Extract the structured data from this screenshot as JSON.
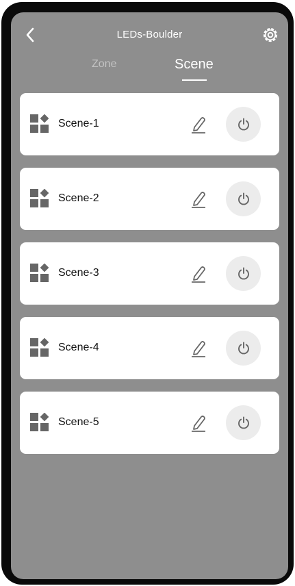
{
  "header": {
    "title": "LEDs-Boulder",
    "back_icon": "chevron-left-icon",
    "settings_icon": "gear-icon"
  },
  "tabs": [
    {
      "label": "Zone",
      "active": false
    },
    {
      "label": "Scene",
      "active": true
    }
  ],
  "scenes": [
    {
      "name": "Scene-1",
      "icon": "scene-grid-icon",
      "edit_icon": "pencil-icon",
      "power_icon": "power-icon"
    },
    {
      "name": "Scene-2",
      "icon": "scene-grid-icon",
      "edit_icon": "pencil-icon",
      "power_icon": "power-icon"
    },
    {
      "name": "Scene-3",
      "icon": "scene-grid-icon",
      "edit_icon": "pencil-icon",
      "power_icon": "power-icon"
    },
    {
      "name": "Scene-4",
      "icon": "scene-grid-icon",
      "edit_icon": "pencil-icon",
      "power_icon": "power-icon"
    },
    {
      "name": "Scene-5",
      "icon": "scene-grid-icon",
      "edit_icon": "pencil-icon",
      "power_icon": "power-icon"
    }
  ],
  "colors": {
    "background": "#8e8e8e",
    "card": "#ffffff",
    "power_button": "#ececec",
    "icon": "#666666",
    "frame": "#0a0a0a"
  }
}
